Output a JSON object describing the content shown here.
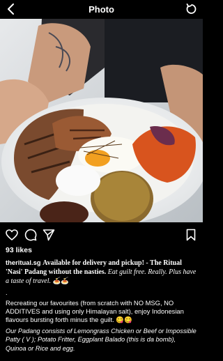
{
  "header": {
    "title": "Photo"
  },
  "post": {
    "likes": "93 likes",
    "caption": {
      "username": "theritual.sg",
      "headline": "Available for delivery and pickup! - The Ritual 'Nasi' Padang without the nasties.",
      "tagline": "Eat guilt free. Really. Plus have a taste of travel.",
      "tagline_emoji": "🍝🍝",
      "dot": ".",
      "para1": "Recreating our favourites (from scratch with NO MSG, NO ADDITIVES and using only Himalayan salt), enjoy Indonesian flavours bursting forth minus the guilt.",
      "para1_emoji": "😋😋",
      "para2": "Our Padang consists of Lemongrass Chicken or Beef or Impossible Patty ( V ); Potato Fritter, Eggplant Balado (this is da bomb), Quinoa or Rice and egg."
    }
  },
  "icons": {
    "back": "chevron-left-icon",
    "refresh": "refresh-icon",
    "like": "heart-icon",
    "comment": "comment-icon",
    "share": "send-icon",
    "save": "bookmark-icon"
  }
}
